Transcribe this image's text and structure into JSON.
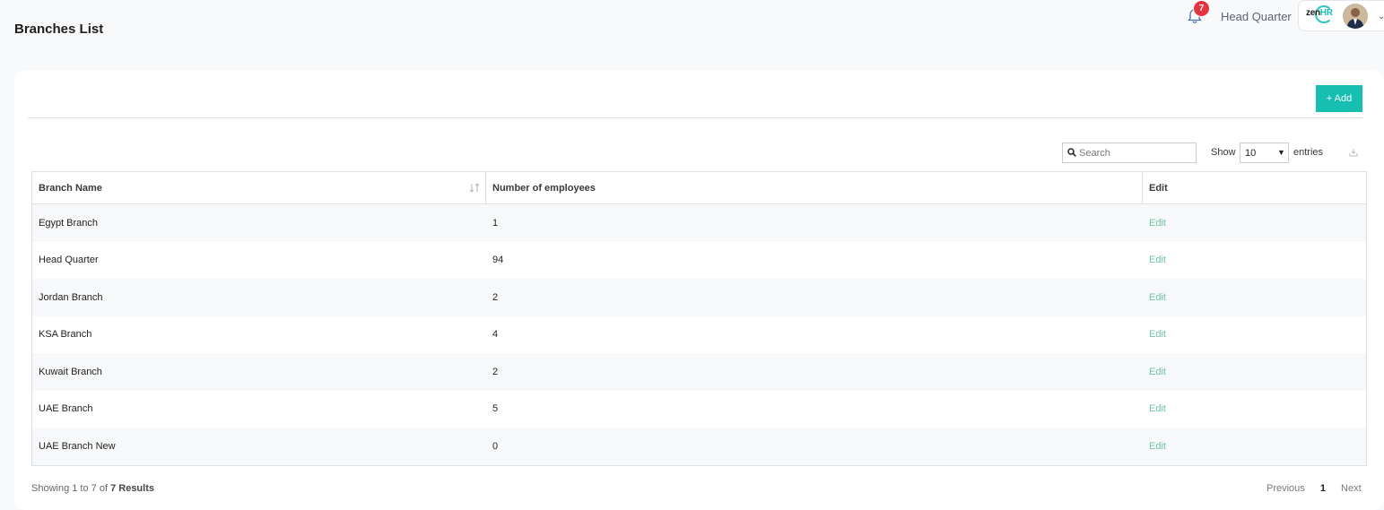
{
  "page": {
    "title": "Branches List"
  },
  "header": {
    "notifications_count": "7",
    "branch": "Head Quarter",
    "logo_text": "zen",
    "logo_accent": "HR"
  },
  "toolbar": {
    "add_label": "+ Add",
    "search_placeholder": "Search",
    "show_label": "Show",
    "page_size": "10",
    "entries_label": "entries"
  },
  "table": {
    "headers": [
      "Branch Name",
      "Number of employees",
      "Edit"
    ],
    "rows": [
      {
        "name": "Egypt Branch",
        "employees": "1",
        "edit": "Edit"
      },
      {
        "name": "Head Quarter",
        "employees": "94",
        "edit": "Edit"
      },
      {
        "name": "Jordan Branch",
        "employees": "2",
        "edit": "Edit"
      },
      {
        "name": "KSA Branch",
        "employees": "4",
        "edit": "Edit"
      },
      {
        "name": "Kuwait Branch",
        "employees": "2",
        "edit": "Edit"
      },
      {
        "name": "UAE Branch",
        "employees": "5",
        "edit": "Edit"
      },
      {
        "name": "UAE Branch New",
        "employees": "0",
        "edit": "Edit"
      }
    ]
  },
  "footer": {
    "showing_prefix": "Showing 1 to 7 of",
    "total": "7 Results",
    "previous": "Previous",
    "current_page": "1",
    "next": "Next"
  },
  "colors": {
    "accent": "#16bfb0",
    "edit_link": "#6ec4a8",
    "badge": "#e4343f"
  }
}
